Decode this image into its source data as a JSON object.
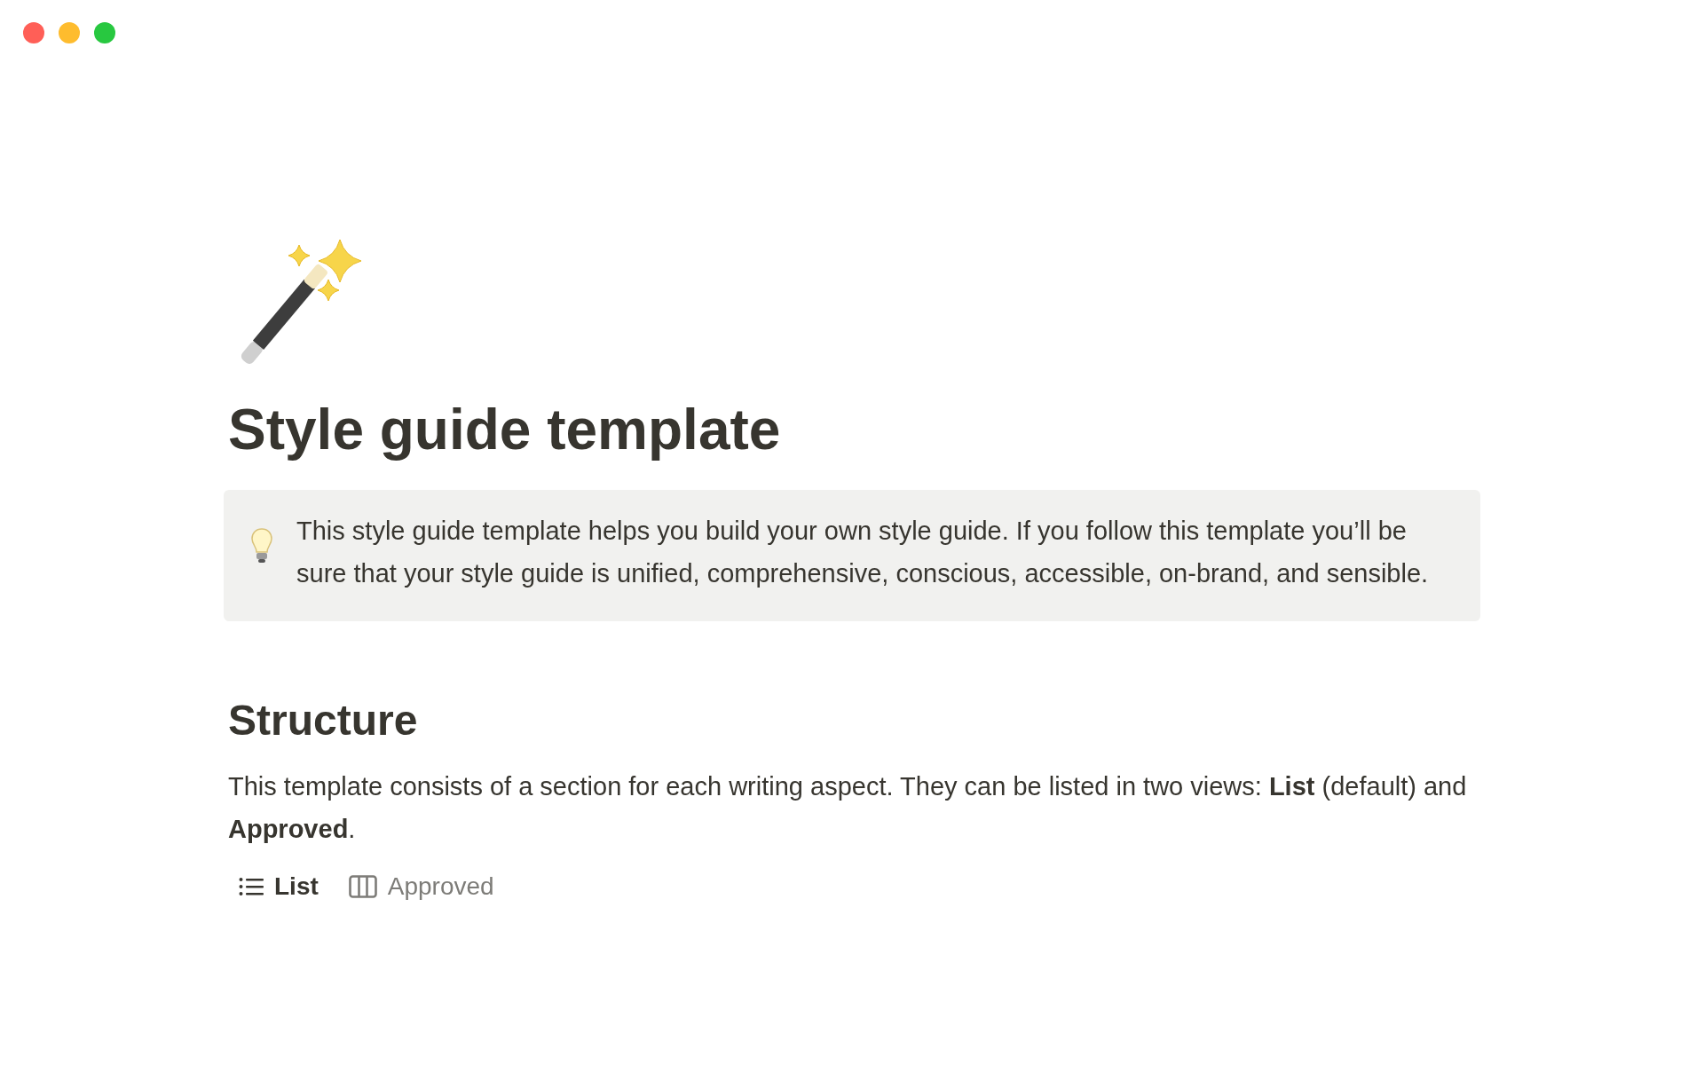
{
  "window": {
    "controls": [
      {
        "color": "#ff5f57"
      },
      {
        "color": "#febc2e"
      },
      {
        "color": "#28c840"
      }
    ]
  },
  "page": {
    "title": "Style guide template"
  },
  "callout": {
    "text": "This style guide template helps you build your own style guide. If you follow this template you’ll be sure that your style guide is unified, comprehensive, conscious, accessible, on-brand, and sensible."
  },
  "section": {
    "heading": "Structure",
    "paragraph": "This template consists of a section for each writing aspect. They can be listed in two views: **List** (default) and **Approved**."
  },
  "views": [
    {
      "kind": "list",
      "label": "List",
      "selected": true
    },
    {
      "kind": "board",
      "label": "Approved",
      "selected": false
    }
  ]
}
